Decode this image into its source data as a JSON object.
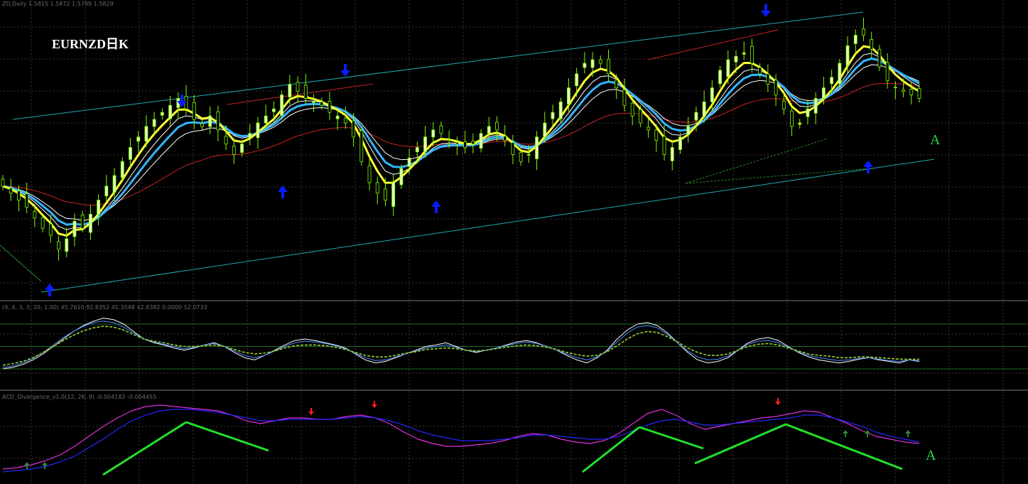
{
  "header": {
    "main_info": "ZD,Daily  1.5815 1.5872 1.5799 1.5829",
    "stoch_info": "(9, 4, 3, 3, 20, 1.00) 45.7610 82.8352 41.3548 42.8382 0.0000 52.0733",
    "macd_info": "ACD_Divergence_v1.0(12, 26, 9) -0.004182 -0.004455"
  },
  "title": "EURNZD日K",
  "labels": {
    "price_marker": "A",
    "macd_marker": "A"
  },
  "colors": {
    "background": "#000000",
    "grid": "#3a3a3a",
    "candle_body": "#e6ffb8",
    "candle_wick": "#7cfc00",
    "ma_yellow": "#ffff33",
    "ma_cyan": "#33b5ff",
    "ma_white": "#ffffff",
    "ma_red": "#cc2222",
    "channel": "#22a8b5",
    "fractal_arrow": "#0a1bff",
    "osc_green": "#9acd32",
    "osc_blue": "#4a8cff",
    "macd_magenta": "#e030e0",
    "macd_blue": "#2626ff",
    "annotation_green": "#22e02a",
    "sell_arrow": "#ff2020",
    "buy_arrow": "#2a8a2a"
  },
  "chart_data": [
    {
      "type": "candlestick",
      "symbol": "EURNZD",
      "timeframe": "Daily",
      "grid": true,
      "close": [
        1.69,
        1.688,
        1.686,
        1.684,
        1.681,
        1.678,
        1.676,
        1.672,
        1.675,
        1.68,
        1.678,
        1.682,
        1.686,
        1.69,
        1.693,
        1.697,
        1.701,
        1.704,
        1.707,
        1.709,
        1.711,
        1.713,
        1.715,
        1.712,
        1.709,
        1.707,
        1.71,
        1.706,
        1.702,
        1.699,
        1.702,
        1.705,
        1.708,
        1.71,
        1.712,
        1.716,
        1.719,
        1.717,
        1.715,
        1.714,
        1.713,
        1.711,
        1.71,
        1.708,
        1.704,
        1.697,
        1.691,
        1.688,
        1.686,
        1.691,
        1.695,
        1.698,
        1.701,
        1.704,
        1.706,
        1.705,
        1.703,
        1.702,
        1.701,
        1.702,
        1.705,
        1.707,
        1.706,
        1.703,
        1.699,
        1.697,
        1.699,
        1.704,
        1.708,
        1.711,
        1.714,
        1.718,
        1.722,
        1.725,
        1.726,
        1.725,
        1.722,
        1.718,
        1.713,
        1.71,
        1.708,
        1.706,
        1.703,
        1.699,
        1.701,
        1.704,
        1.707,
        1.711,
        1.714,
        1.718,
        1.723,
        1.726,
        1.727,
        1.728,
        1.725,
        1.722,
        1.719,
        1.716,
        1.712,
        1.707,
        1.708,
        1.712,
        1.715,
        1.718,
        1.721,
        1.725,
        1.73,
        1.733,
        1.733,
        1.729,
        1.724,
        1.72,
        1.718,
        1.717,
        1.716,
        1.715
      ],
      "ma_series": [
        {
          "color": "yellow",
          "role": "fast MA"
        },
        {
          "color": "cyan",
          "role": "MA"
        },
        {
          "color": "white",
          "role": "envelope"
        },
        {
          "color": "red",
          "role": "slow MA"
        }
      ]
    },
    {
      "type": "line",
      "panel": "stochastic oscillator",
      "levels": [
        80,
        50,
        20
      ],
      "series": [
        {
          "color": "white",
          "values": [
            20,
            22,
            26,
            32,
            40,
            50,
            60,
            70,
            78,
            84,
            88,
            86,
            80,
            70,
            60,
            55,
            52,
            48,
            45,
            48,
            52,
            55,
            50,
            42,
            35,
            32,
            38,
            45,
            52,
            58,
            60,
            58,
            55,
            52,
            48,
            40,
            32,
            28,
            30,
            35,
            40,
            45,
            50,
            52,
            55,
            50,
            45,
            42,
            45,
            48,
            52,
            56,
            58,
            55,
            50,
            45,
            38,
            32,
            28,
            35,
            45,
            60,
            72,
            80,
            82,
            78,
            68,
            55,
            42,
            32,
            28,
            30,
            35,
            45,
            55,
            60,
            62,
            58,
            50,
            42,
            36,
            32,
            30,
            28,
            30,
            33,
            35,
            32,
            30,
            28,
            32,
            30
          ]
        },
        {
          "color": "blue",
          "values": [
            22,
            24,
            28,
            34,
            42,
            52,
            62,
            70,
            77,
            82,
            84,
            82,
            76,
            68,
            60,
            56,
            53,
            50,
            47,
            49,
            52,
            54,
            50,
            44,
            38,
            35,
            38,
            44,
            50,
            55,
            57,
            56,
            54,
            51,
            47,
            41,
            35,
            31,
            32,
            36,
            40,
            44,
            48,
            50,
            52,
            49,
            45,
            43,
            45,
            48,
            51,
            54,
            56,
            54,
            50,
            45,
            40,
            35,
            32,
            36,
            44,
            56,
            68,
            76,
            78,
            75,
            66,
            55,
            44,
            36,
            32,
            33,
            37,
            45,
            53,
            57,
            58,
            55,
            49,
            43,
            38,
            35,
            33,
            31,
            32,
            34,
            35,
            33,
            31,
            30,
            32,
            31
          ]
        },
        {
          "color": "green",
          "values": [
            25,
            27,
            30,
            35,
            42,
            50,
            58,
            65,
            71,
            75,
            77,
            76,
            72,
            66,
            60,
            57,
            55,
            52,
            50,
            50,
            51,
            52,
            50,
            46,
            42,
            40,
            41,
            44,
            48,
            51,
            52,
            52,
            51,
            49,
            46,
            42,
            38,
            36,
            36,
            38,
            41,
            43,
            46,
            47,
            48,
            47,
            45,
            44,
            45,
            47,
            49,
            51,
            52,
            51,
            49,
            46,
            42,
            39,
            37,
            38,
            43,
            51,
            60,
            67,
            70,
            69,
            63,
            56,
            48,
            42,
            38,
            38,
            40,
            45,
            50,
            53,
            54,
            52,
            48,
            44,
            40,
            38,
            37,
            35,
            35,
            36,
            36,
            35,
            34,
            33,
            33,
            33
          ]
        }
      ]
    },
    {
      "type": "line",
      "panel": "MACD divergence",
      "series": [
        {
          "color": "magenta",
          "values": [
            -0.03,
            -0.029,
            -0.027,
            -0.024,
            -0.02,
            -0.014,
            -0.007,
            0.0,
            0.006,
            0.011,
            0.014,
            0.015,
            0.014,
            0.013,
            0.012,
            0.011,
            0.008,
            0.004,
            0.002,
            0.004,
            0.006,
            0.006,
            0.005,
            0.005,
            0.007,
            0.008,
            0.006,
            0.002,
            -0.004,
            -0.009,
            -0.012,
            -0.014,
            -0.014,
            -0.013,
            -0.012,
            -0.01,
            -0.007,
            -0.005,
            -0.006,
            -0.009,
            -0.011,
            -0.012,
            -0.01,
            -0.005,
            0.002,
            0.009,
            0.012,
            0.008,
            0.002,
            -0.002,
            0.0,
            0.002,
            0.004,
            0.006,
            0.007,
            0.009,
            0.011,
            0.01,
            0.006,
            0.002,
            -0.003,
            -0.007,
            -0.009,
            -0.011,
            -0.012
          ]
        },
        {
          "color": "blue",
          "values": [
            -0.032,
            -0.031,
            -0.03,
            -0.028,
            -0.025,
            -0.021,
            -0.015,
            -0.009,
            -0.002,
            0.004,
            0.008,
            0.011,
            0.012,
            0.012,
            0.011,
            0.01,
            0.008,
            0.006,
            0.004,
            0.004,
            0.005,
            0.005,
            0.005,
            0.005,
            0.006,
            0.007,
            0.006,
            0.004,
            0.001,
            -0.003,
            -0.006,
            -0.008,
            -0.01,
            -0.01,
            -0.01,
            -0.009,
            -0.008,
            -0.006,
            -0.006,
            -0.007,
            -0.008,
            -0.009,
            -0.009,
            -0.007,
            -0.003,
            0.001,
            0.004,
            0.005,
            0.003,
            0.001,
            0.001,
            0.002,
            0.003,
            0.004,
            0.005,
            0.006,
            0.008,
            0.008,
            0.006,
            0.003,
            0.0,
            -0.004,
            -0.007,
            -0.009,
            -0.011
          ]
        }
      ]
    }
  ]
}
